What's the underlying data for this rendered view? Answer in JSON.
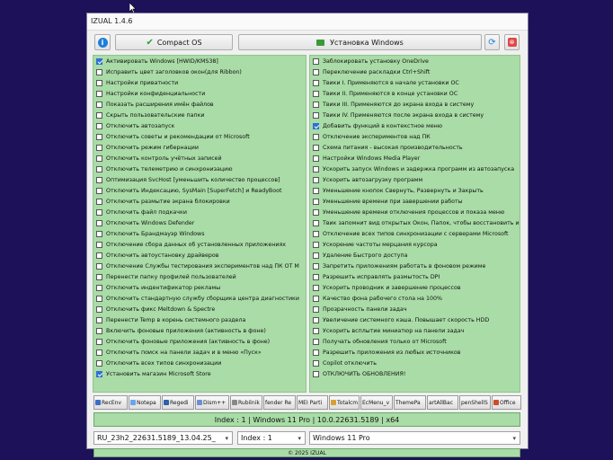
{
  "window": {
    "title": "IZUAL 1.4.6"
  },
  "toolbar": {
    "info_icon": "info-icon",
    "compact_label": "Compact OS",
    "install_label": "Установка Windows",
    "refresh_icon": "refresh-icon",
    "close_icon": "close-icon"
  },
  "left_items": [
    {
      "label": "Активировать Windows [HWID/KMS38]",
      "checked": true
    },
    {
      "label": "Исправить цвет заголовков окон(для Ribbon)",
      "checked": false
    },
    {
      "label": "Настройки приватности",
      "checked": false
    },
    {
      "label": "Настройки конфиденциальности",
      "checked": false
    },
    {
      "label": "Показать расширения имён файлов",
      "checked": false
    },
    {
      "label": "Скрыть пользовательские папки",
      "checked": false
    },
    {
      "label": "Отключить автозапуск",
      "checked": false
    },
    {
      "label": "Отключить советы и рекомендации от Microsoft",
      "checked": false
    },
    {
      "label": "Отключить режим гибернации",
      "checked": false
    },
    {
      "label": "Отключить контроль учётных записей",
      "checked": false
    },
    {
      "label": "Отключить телеметрию и синхронизацию",
      "checked": false
    },
    {
      "label": "Оптимизация SvcHost [уменьшить количество процессов]",
      "checked": false
    },
    {
      "label": "Отключить Индексацию, SysMain [SuperFetch] и ReadyBoot",
      "checked": false
    },
    {
      "label": "Отключить размытие экрана блокировки",
      "checked": false
    },
    {
      "label": "Отключить файл подкачки",
      "checked": false
    },
    {
      "label": "Отключить Windows Defender",
      "checked": false
    },
    {
      "label": "Отключить Брандмауэр Windows",
      "checked": false
    },
    {
      "label": "Отключение сбора данных об установленных приложениях",
      "checked": false
    },
    {
      "label": "Отключить автоустановку драйверов",
      "checked": false
    },
    {
      "label": "Отключение Службы тестирования экспериментов над ПК ОТ М",
      "checked": false
    },
    {
      "label": "Перенести папку профилей пользователей",
      "checked": false
    },
    {
      "label": "Отключить индентификатор рекламы",
      "checked": false
    },
    {
      "label": "Отключить стандартную службу сборщика центра диагностики",
      "checked": false
    },
    {
      "label": "Отключить фикс Meltdown & Spectre",
      "checked": false
    },
    {
      "label": "Перенести Temp в корень системного раздела",
      "checked": false
    },
    {
      "label": "Включить фоновые приложения (активность в фоне)",
      "checked": false
    },
    {
      "label": "Отключить фоновые приложения (активность в фоне)",
      "checked": false
    },
    {
      "label": "Отключить поиск на панели задач и в меню «Пуск»",
      "checked": false
    },
    {
      "label": "Отключить всех типов синхронизации",
      "checked": false
    },
    {
      "label": "Установить магазин Microsoft Store",
      "checked": true
    }
  ],
  "right_items": [
    {
      "label": "Заблокировать установку OneDrive",
      "checked": false
    },
    {
      "label": "Переключение раскладки Ctrl+Shift",
      "checked": false
    },
    {
      "label": "Твики I. Применяются в начале установки ОС",
      "checked": false
    },
    {
      "label": "Твики II. Применяются в конце установки ОС",
      "checked": false
    },
    {
      "label": "Твики III. Применяются до экрана входа в систему",
      "checked": false
    },
    {
      "label": "Твики IV. Применяются после экрана входа в систему",
      "checked": false
    },
    {
      "label": "Добавить функций в контекстное меню",
      "checked": true
    },
    {
      "label": "Отключение экспериментов над ПК",
      "checked": false
    },
    {
      "label": "Схема питания - высокая производительность",
      "checked": false
    },
    {
      "label": "Настройки Windows Media Player",
      "checked": false
    },
    {
      "label": "Ускорить запуск Windows и задержка программ из автозапуска",
      "checked": false
    },
    {
      "label": "Ускорить автозагрузку программ",
      "checked": false
    },
    {
      "label": "Уменьшение кнопок Свернуть, Развернуть и Закрыть",
      "checked": false
    },
    {
      "label": "Уменьшение времени при завершении работы",
      "checked": false
    },
    {
      "label": "Уменьшение времени отключения процессов и показа меню",
      "checked": false
    },
    {
      "label": "Твик запомнит вид открытых Окон, Папок, чтобы восстановить и",
      "checked": false
    },
    {
      "label": "Отключение всех типов синхронизации с серверами Microsoft",
      "checked": false
    },
    {
      "label": "Ускорение частоты мерцания курсора",
      "checked": false
    },
    {
      "label": "Удаление Быстрого доступа",
      "checked": false
    },
    {
      "label": "Запретить приложениям работать в фоновом режиме",
      "checked": false
    },
    {
      "label": "Разрешить исправлять размытость DPI",
      "checked": false
    },
    {
      "label": "Ускорить проводник и завершение процессов",
      "checked": false
    },
    {
      "label": "Качество фона рабочего стола на 100%",
      "checked": false
    },
    {
      "label": "Прозрачность панели задач",
      "checked": false
    },
    {
      "label": "Увеличение системного кэша. Повышает скорость HDD",
      "checked": false
    },
    {
      "label": "Ускорить всплытие миниатюр на панели задач",
      "checked": false
    },
    {
      "label": "Получать обновления только от Microsoft",
      "checked": false
    },
    {
      "label": "Разрешить приложения из любых источников",
      "checked": false
    },
    {
      "label": "Copilot отключить",
      "checked": false
    },
    {
      "label": "ОТКЛЮЧИТЬ ОБНОВЛЕНИЯ!",
      "checked": false
    }
  ],
  "tools": [
    {
      "label": "RecEnv",
      "color": "#3a6fc4"
    },
    {
      "label": "Notepa",
      "color": "#6aa5e8"
    },
    {
      "label": "Regedi",
      "color": "#2e5fa8"
    },
    {
      "label": "Dism++",
      "color": "#6b8fd0"
    },
    {
      "label": "Rubilnik",
      "color": "#888888"
    },
    {
      "label": "fender Re",
      "color": ""
    },
    {
      "label": "MEI Parti",
      "color": ""
    },
    {
      "label": "Totalcm",
      "color": "#d9a030"
    },
    {
      "label": "EcMenu_v",
      "color": ""
    },
    {
      "label": "ThemePa",
      "color": ""
    },
    {
      "label": "artAllBac",
      "color": ""
    },
    {
      "label": "penShellS",
      "color": ""
    },
    {
      "label": "Office",
      "color": "#d04a2a"
    }
  ],
  "status": {
    "text": "Index : 1 | Windows 11 Pro | 10.0.22631.5189 | x64"
  },
  "selects": {
    "image": "RU_23h2_22631.5189_13.04.25_",
    "index": "Index : 1",
    "edition": "Windows 11 Pro"
  },
  "footer": {
    "text": "© 2025 IZUAL"
  },
  "colors": {
    "accent_green": "#a9dca6",
    "desktop": "#1d1159"
  }
}
